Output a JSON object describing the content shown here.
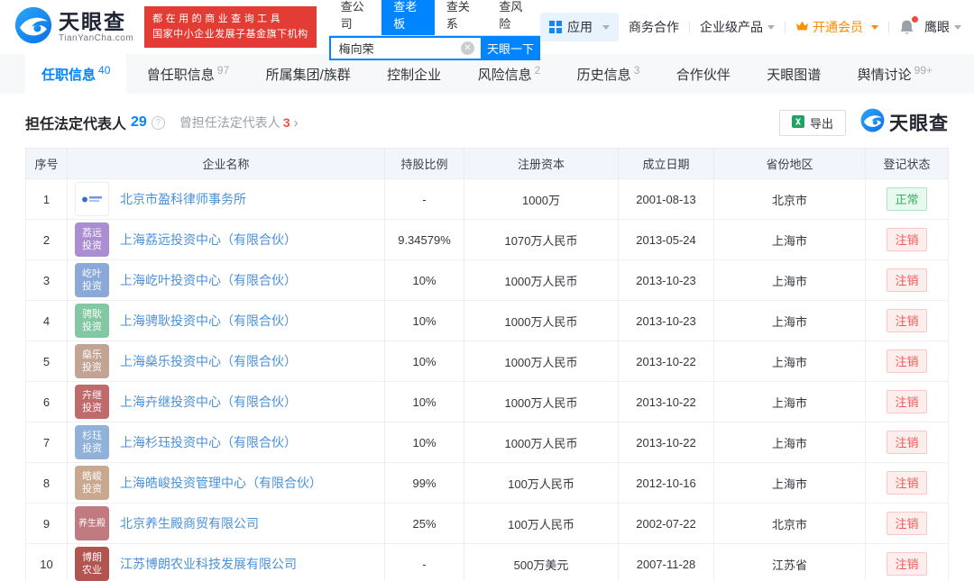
{
  "colors": {
    "brand_blue": "#0084ff",
    "promo_red": "#e23c35",
    "link_blue": "#4a90d9",
    "vip_orange": "#ff8a00",
    "status_normal_green": "#2bb562",
    "status_cancelled_red": "#f25a55"
  },
  "header": {
    "logo": {
      "title": "天眼查",
      "subtitle": "TianYanCha.com"
    },
    "promo_badge": {
      "line1": "都在用的商业查询工具",
      "line2": "国家中小企业发展子基金旗下机构"
    },
    "search": {
      "tabs": [
        {
          "label": "查公司",
          "active": false
        },
        {
          "label": "查老板",
          "active": true
        },
        {
          "label": "查关系",
          "active": false
        },
        {
          "label": "查风险",
          "active": false
        }
      ],
      "value": "梅向荣",
      "button": "天眼一下"
    },
    "nav": {
      "apps": "应用",
      "business": "商务合作",
      "enterprise": "企业级产品",
      "vip": "开通会员",
      "eagle": "鹰眼"
    }
  },
  "tabs": [
    {
      "label": "任职信息",
      "count": "40",
      "active": true
    },
    {
      "label": "曾任职信息",
      "count": "97",
      "active": false
    },
    {
      "label": "所属集团/族群",
      "count": "",
      "active": false
    },
    {
      "label": "控制企业",
      "count": "",
      "active": false
    },
    {
      "label": "风险信息",
      "count": "2",
      "active": false
    },
    {
      "label": "历史信息",
      "count": "3",
      "active": false
    },
    {
      "label": "合作伙伴",
      "count": "",
      "active": false
    },
    {
      "label": "天眼图谱",
      "count": "",
      "active": false
    },
    {
      "label": "舆情讨论",
      "count": "99+",
      "active": false
    }
  ],
  "section": {
    "title": "担任法定代表人",
    "count": "29",
    "secondary_title": "曾担任法定代表人",
    "secondary_count": "3",
    "export": "导出",
    "watermark": "天眼查"
  },
  "table": {
    "columns": [
      "序号",
      "企业名称",
      "持股比例",
      "注册资本",
      "成立日期",
      "省份地区",
      "登记状态"
    ],
    "rows": [
      {
        "no": "1",
        "name": "北京市盈科律师事务所",
        "logo_line1": "",
        "logo_line2": "",
        "logo_bg": "#ffffff",
        "logo_white": true,
        "ratio": "-",
        "capital": "1000万",
        "date": "2001-08-13",
        "region": "北京市",
        "status": "正常",
        "status_type": "normal"
      },
      {
        "no": "2",
        "name": "上海荔远投资中心（有限合伙）",
        "logo_line1": "荔远",
        "logo_line2": "投资",
        "logo_bg": "#ab8ed1",
        "logo_white": false,
        "ratio": "9.34579%",
        "capital": "1070万人民币",
        "date": "2013-05-24",
        "region": "上海市",
        "status": "注销",
        "status_type": "cancelled"
      },
      {
        "no": "3",
        "name": "上海屹叶投资中心（有限合伙）",
        "logo_line1": "屹叶",
        "logo_line2": "投资",
        "logo_bg": "#8aa9d9",
        "logo_white": false,
        "ratio": "10%",
        "capital": "1000万人民币",
        "date": "2013-10-23",
        "region": "上海市",
        "status": "注销",
        "status_type": "cancelled"
      },
      {
        "no": "4",
        "name": "上海骋耿投资中心（有限合伙）",
        "logo_line1": "骋耿",
        "logo_line2": "投资",
        "logo_bg": "#84c7a3",
        "logo_white": false,
        "ratio": "10%",
        "capital": "1000万人民币",
        "date": "2013-10-23",
        "region": "上海市",
        "status": "注销",
        "status_type": "cancelled"
      },
      {
        "no": "5",
        "name": "上海燊乐投资中心（有限合伙）",
        "logo_line1": "燊乐",
        "logo_line2": "投资",
        "logo_bg": "#c3a393",
        "logo_white": false,
        "ratio": "10%",
        "capital": "1000万人民币",
        "date": "2013-10-22",
        "region": "上海市",
        "status": "注销",
        "status_type": "cancelled"
      },
      {
        "no": "6",
        "name": "上海卉继投资中心（有限合伙）",
        "logo_line1": "卉继",
        "logo_line2": "投资",
        "logo_bg": "#bf6b6c",
        "logo_white": false,
        "ratio": "10%",
        "capital": "1000万人民币",
        "date": "2013-10-22",
        "region": "上海市",
        "status": "注销",
        "status_type": "cancelled"
      },
      {
        "no": "7",
        "name": "上海杉珏投资中心（有限合伙）",
        "logo_line1": "杉珏",
        "logo_line2": "投资",
        "logo_bg": "#8fb1da",
        "logo_white": false,
        "ratio": "10%",
        "capital": "1000万人民币",
        "date": "2013-10-22",
        "region": "上海市",
        "status": "注销",
        "status_type": "cancelled"
      },
      {
        "no": "8",
        "name": "上海皓峻投资管理中心（有限合伙）",
        "logo_line1": "皓峻",
        "logo_line2": "投资",
        "logo_bg": "#c9a88f",
        "logo_white": false,
        "ratio": "99%",
        "capital": "100万人民币",
        "date": "2012-10-16",
        "region": "上海市",
        "status": "注销",
        "status_type": "cancelled"
      },
      {
        "no": "9",
        "name": "北京养生殿商贸有限公司",
        "logo_line1": "养生殿",
        "logo_line2": "",
        "logo_bg": "#c17b80",
        "logo_white": false,
        "ratio": "25%",
        "capital": "100万人民币",
        "date": "2002-07-22",
        "region": "北京市",
        "status": "注销",
        "status_type": "cancelled"
      },
      {
        "no": "10",
        "name": "江苏博朗农业科技发展有限公司",
        "logo_line1": "博朗",
        "logo_line2": "农业",
        "logo_bg": "#b2544f",
        "logo_white": false,
        "ratio": "-",
        "capital": "500万美元",
        "date": "2007-11-28",
        "region": "江苏省",
        "status": "注销",
        "status_type": "cancelled"
      }
    ]
  }
}
